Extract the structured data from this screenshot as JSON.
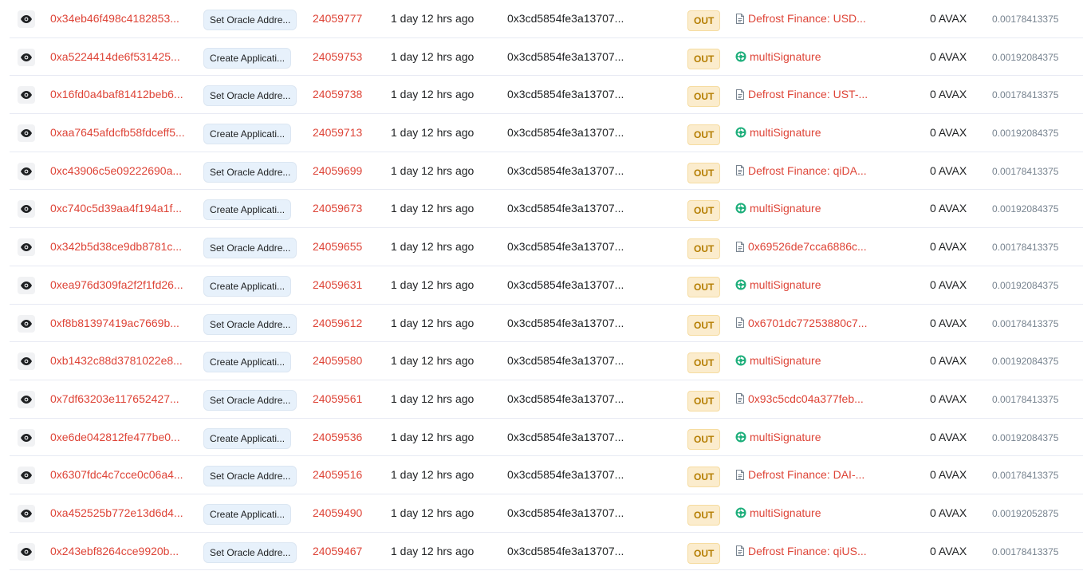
{
  "colors": {
    "link": "#de4437",
    "text": "#1e2022",
    "muted": "#77838f",
    "out_badge_bg": "#fbeccd",
    "out_badge_text": "#b47d00",
    "method_bg": "#e7f1fb",
    "multisig_icon": "#1cae7a"
  },
  "icons": {
    "preview": "eye-icon",
    "contract": "contract-document-icon",
    "multisig": "multisignature-icon"
  },
  "rows": [
    {
      "hash": "0x34eb46f498c4182853...",
      "method": "Set Oracle Addre...",
      "block": "24059777",
      "age": "1 day 12 hrs ago",
      "from": "0x3cd5854fe3a13707...",
      "direction": "OUT",
      "to_type": "contract",
      "to": "Defrost Finance: USD...",
      "value": "0 AVAX",
      "fee": "0.00178413375"
    },
    {
      "hash": "0xa5224414de6f531425...",
      "method": "Create Applicati...",
      "block": "24059753",
      "age": "1 day 12 hrs ago",
      "from": "0x3cd5854fe3a13707...",
      "direction": "OUT",
      "to_type": "multisig",
      "to": "multiSignature",
      "value": "0 AVAX",
      "fee": "0.00192084375"
    },
    {
      "hash": "0x16fd0a4baf81412beb6...",
      "method": "Set Oracle Addre...",
      "block": "24059738",
      "age": "1 day 12 hrs ago",
      "from": "0x3cd5854fe3a13707...",
      "direction": "OUT",
      "to_type": "contract",
      "to": "Defrost Finance: UST-...",
      "value": "0 AVAX",
      "fee": "0.00178413375"
    },
    {
      "hash": "0xaa7645afdcfb58fdceff5...",
      "method": "Create Applicati...",
      "block": "24059713",
      "age": "1 day 12 hrs ago",
      "from": "0x3cd5854fe3a13707...",
      "direction": "OUT",
      "to_type": "multisig",
      "to": "multiSignature",
      "value": "0 AVAX",
      "fee": "0.00192084375"
    },
    {
      "hash": "0xc43906c5e09222690a...",
      "method": "Set Oracle Addre...",
      "block": "24059699",
      "age": "1 day 12 hrs ago",
      "from": "0x3cd5854fe3a13707...",
      "direction": "OUT",
      "to_type": "contract",
      "to": "Defrost Finance: qiDA...",
      "value": "0 AVAX",
      "fee": "0.00178413375"
    },
    {
      "hash": "0xc740c5d39aa4f194a1f...",
      "method": "Create Applicati...",
      "block": "24059673",
      "age": "1 day 12 hrs ago",
      "from": "0x3cd5854fe3a13707...",
      "direction": "OUT",
      "to_type": "multisig",
      "to": "multiSignature",
      "value": "0 AVAX",
      "fee": "0.00192084375"
    },
    {
      "hash": "0x342b5d38ce9db8781c...",
      "method": "Set Oracle Addre...",
      "block": "24059655",
      "age": "1 day 12 hrs ago",
      "from": "0x3cd5854fe3a13707...",
      "direction": "OUT",
      "to_type": "contract",
      "to": "0x69526de7cca6886c...",
      "value": "0 AVAX",
      "fee": "0.00178413375"
    },
    {
      "hash": "0xea976d309fa2f2f1fd26...",
      "method": "Create Applicati...",
      "block": "24059631",
      "age": "1 day 12 hrs ago",
      "from": "0x3cd5854fe3a13707...",
      "direction": "OUT",
      "to_type": "multisig",
      "to": "multiSignature",
      "value": "0 AVAX",
      "fee": "0.00192084375"
    },
    {
      "hash": "0xf8b81397419ac7669b...",
      "method": "Set Oracle Addre...",
      "block": "24059612",
      "age": "1 day 12 hrs ago",
      "from": "0x3cd5854fe3a13707...",
      "direction": "OUT",
      "to_type": "contract",
      "to": "0x6701dc77253880c7...",
      "value": "0 AVAX",
      "fee": "0.00178413375"
    },
    {
      "hash": "0xb1432c88d3781022e8...",
      "method": "Create Applicati...",
      "block": "24059580",
      "age": "1 day 12 hrs ago",
      "from": "0x3cd5854fe3a13707...",
      "direction": "OUT",
      "to_type": "multisig",
      "to": "multiSignature",
      "value": "0 AVAX",
      "fee": "0.00192084375"
    },
    {
      "hash": "0x7df63203e117652427...",
      "method": "Set Oracle Addre...",
      "block": "24059561",
      "age": "1 day 12 hrs ago",
      "from": "0x3cd5854fe3a13707...",
      "direction": "OUT",
      "to_type": "contract",
      "to": "0x93c5cdc04a377feb...",
      "value": "0 AVAX",
      "fee": "0.00178413375"
    },
    {
      "hash": "0xe6de042812fe477be0...",
      "method": "Create Applicati...",
      "block": "24059536",
      "age": "1 day 12 hrs ago",
      "from": "0x3cd5854fe3a13707...",
      "direction": "OUT",
      "to_type": "multisig",
      "to": "multiSignature",
      "value": "0 AVAX",
      "fee": "0.00192084375"
    },
    {
      "hash": "0x6307fdc4c7cce0c06a4...",
      "method": "Set Oracle Addre...",
      "block": "24059516",
      "age": "1 day 12 hrs ago",
      "from": "0x3cd5854fe3a13707...",
      "direction": "OUT",
      "to_type": "contract",
      "to": "Defrost Finance: DAI-...",
      "value": "0 AVAX",
      "fee": "0.00178413375"
    },
    {
      "hash": "0xa452525b772e13d6d4...",
      "method": "Create Applicati...",
      "block": "24059490",
      "age": "1 day 12 hrs ago",
      "from": "0x3cd5854fe3a13707...",
      "direction": "OUT",
      "to_type": "multisig",
      "to": "multiSignature",
      "value": "0 AVAX",
      "fee": "0.00192052875"
    },
    {
      "hash": "0x243ebf8264cce9920b...",
      "method": "Set Oracle Addre...",
      "block": "24059467",
      "age": "1 day 12 hrs ago",
      "from": "0x3cd5854fe3a13707...",
      "direction": "OUT",
      "to_type": "contract",
      "to": "Defrost Finance: qiUS...",
      "value": "0 AVAX",
      "fee": "0.00178413375"
    }
  ]
}
